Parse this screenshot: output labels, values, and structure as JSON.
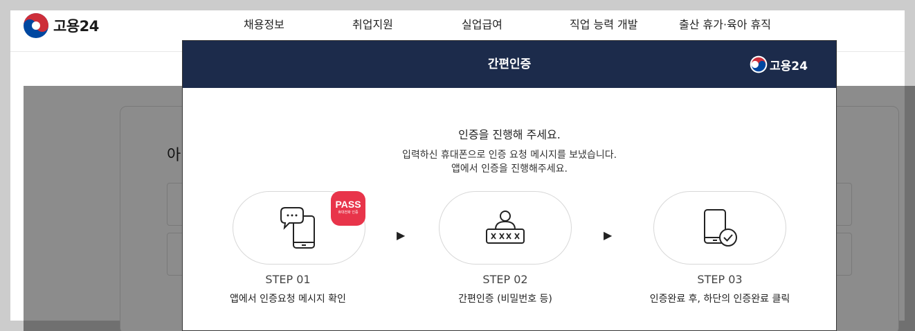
{
  "header": {
    "logo_text": "고용24",
    "nav": [
      "채용정보",
      "취업지원",
      "실업급여",
      "직업 능력 개발",
      "출산 휴가·육아 휴직"
    ]
  },
  "background": {
    "title_fragment": "아"
  },
  "modal": {
    "title": "간편인증",
    "logo_text": "고용24",
    "lead": "인증을 진행해 주세요.",
    "sub_line1": "입력하신 휴대폰으로 인증 요청 메시지를 보냈습니다.",
    "sub_line2": "앱에서 인증을 진행해주세요.",
    "badge_main": "PASS",
    "badge_sub": "휴대전화 인증",
    "steps": [
      {
        "label": "STEP 01",
        "desc": "앱에서 인증요청 메시지 확인",
        "icon": "phone-message-icon"
      },
      {
        "label": "STEP 02",
        "desc": "간편인증 (비밀번호 등)",
        "icon": "user-password-icon"
      },
      {
        "label": "STEP 03",
        "desc": "인증완료 후, 하단의 인증완료 클릭",
        "icon": "phone-check-icon"
      }
    ],
    "arrow": "▶"
  },
  "colors": {
    "modal_header": "#1c2b4b",
    "pass_badge": "#e8344a",
    "logo_red": "#cd2e3a",
    "logo_blue": "#0047a0"
  }
}
